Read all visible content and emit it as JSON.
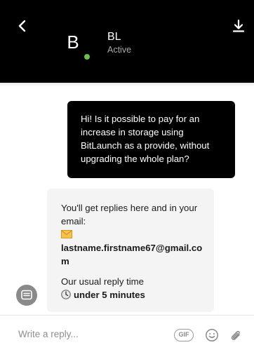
{
  "header": {
    "avatar_initial": "B",
    "agent_name": "BL",
    "agent_status": "Active",
    "status_color": "#6ac14a",
    "back_icon": "chevron-left-icon",
    "download_icon": "download-icon"
  },
  "messages": {
    "outgoing_text": "Hi! Is it possible to pay for an increase in storage using BitLaunch as a provide, without upgrading the whole plan?",
    "incoming": {
      "notify_text": "You'll get replies here and in your email:",
      "email_icon": "envelope-icon",
      "email": "lastname.firstname67@gmail.com",
      "reply_label": "Our usual reply time",
      "clock_icon": "clock-icon",
      "reply_time": "under 5 minutes"
    },
    "bot_icon": "chat-bot-icon"
  },
  "composer": {
    "placeholder": "Write a reply...",
    "gif_label": "GIF",
    "emoji_icon": "emoji-icon",
    "attach_icon": "paperclip-icon"
  }
}
